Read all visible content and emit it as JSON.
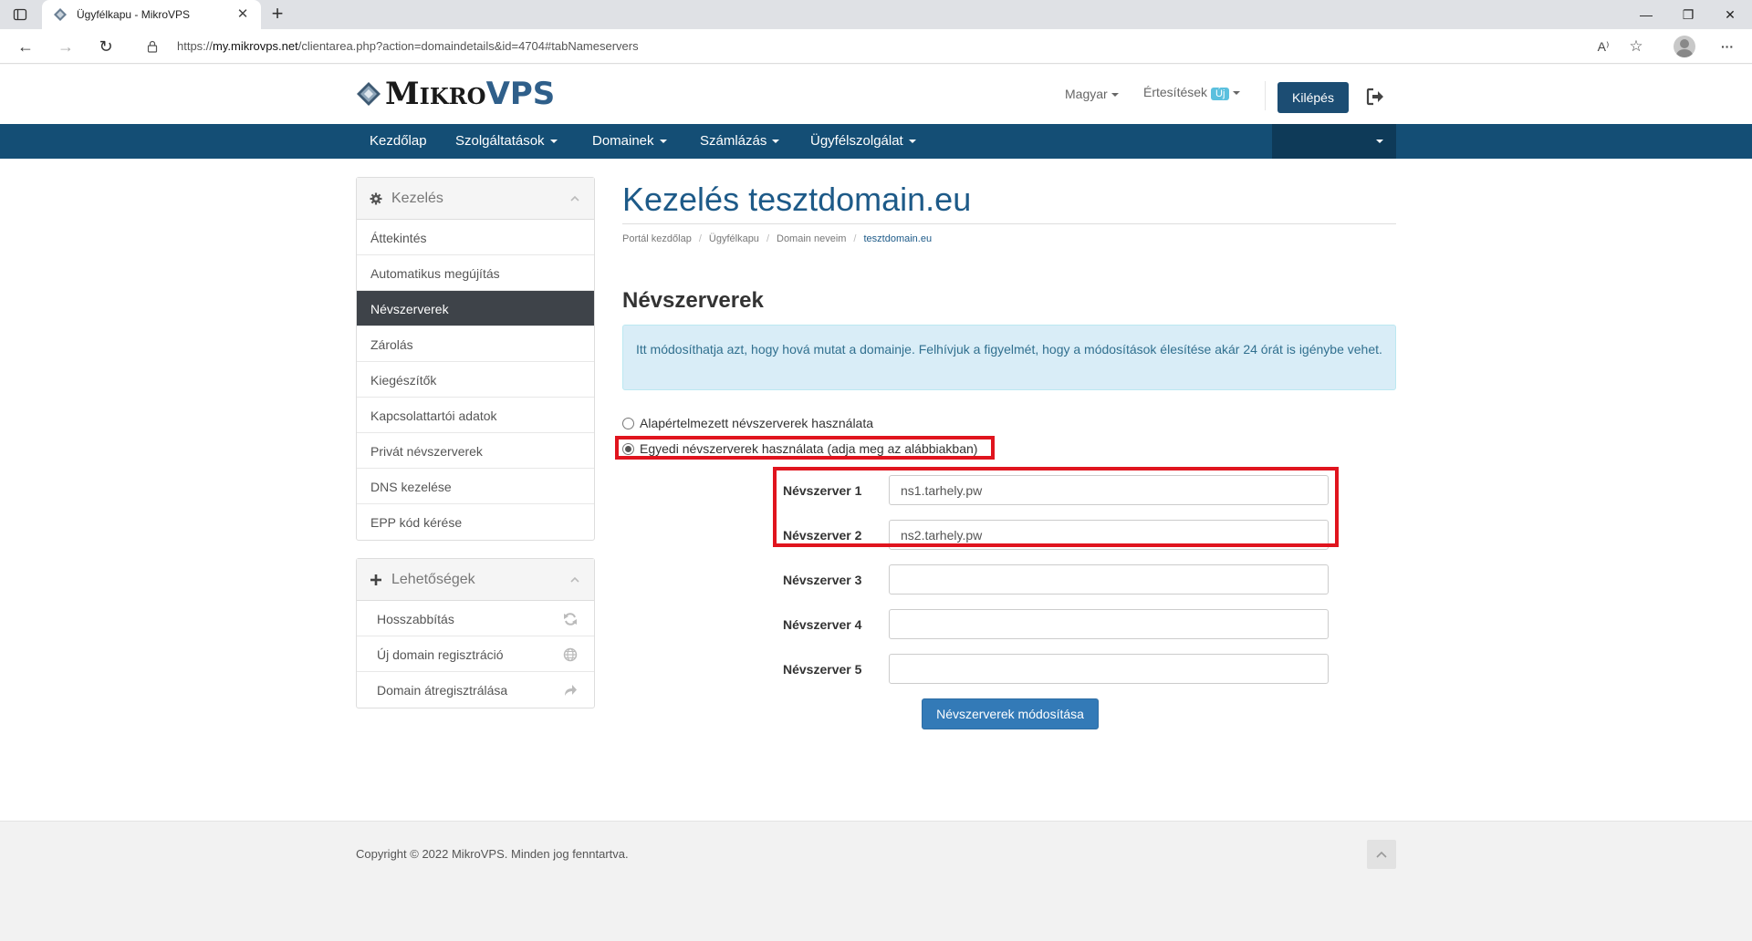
{
  "browser": {
    "tab_title": "Ügyfélkapu - MikroVPS",
    "url_prefix": "https://",
    "url_domain": "my.mikrovps.net",
    "url_path": "/clientarea.php?action=domaindetails&id=4704#tabNameservers",
    "new_tab_symbol": "+",
    "close_symbol": "✕",
    "minimize_symbol": "—",
    "restore_symbol": "❐",
    "window_close_symbol": "✕",
    "back_symbol": "←",
    "forward_symbol": "→",
    "reload_symbol": "↻",
    "read_aloud_symbol": "A⁾",
    "favorites_symbol": "☆",
    "more_symbol": "···"
  },
  "header": {
    "logo_part1": "Mikro",
    "logo_part2": "VPS",
    "language": "Magyar",
    "notifications": "Értesítések",
    "notifications_badge": "Új",
    "logout": "Kilépés"
  },
  "mainnav": {
    "items": [
      "Kezdőlap",
      "Szolgáltatások",
      "Domainek",
      "Számlázás",
      "Ügyfélszolgálat"
    ]
  },
  "sidebar": {
    "manage_title": "Kezelés",
    "manage_items": [
      "Áttekintés",
      "Automatikus megújítás",
      "Névszerverek",
      "Zárolás",
      "Kiegészítők",
      "Kapcsolattartói adatok",
      "Privát névszerverek",
      "DNS kezelése",
      "EPP kód kérése"
    ],
    "active_index": 2,
    "options_title": "Lehetőségek",
    "options_items": [
      "Hosszabbítás",
      "Új domain regisztráció",
      "Domain átregisztrálása"
    ]
  },
  "main": {
    "title": "Kezelés tesztdomain.eu",
    "breadcrumb": [
      "Portál kezdőlap",
      "Ügyfélkapu",
      "Domain neveim",
      "tesztdomain.eu"
    ],
    "section_title": "Névszerverek",
    "info": "Itt módosíthatja azt, hogy hová mutat a domainje. Felhívjuk a figyelmét, hogy a módosítások élesítése akár 24 órát is igénybe vehet.",
    "radio_default": "Alapértelmezett névszerverek használata",
    "radio_custom": "Egyedi névszerverek használata (adja meg az alábbiakban)",
    "radio_selected": "custom",
    "nameservers": [
      {
        "label": "Névszerver 1",
        "value": "ns1.tarhely.pw"
      },
      {
        "label": "Névszerver 2",
        "value": "ns2.tarhely.pw"
      },
      {
        "label": "Névszerver 3",
        "value": ""
      },
      {
        "label": "Névszerver 4",
        "value": ""
      },
      {
        "label": "Névszerver 5",
        "value": ""
      }
    ],
    "submit": "Névszerverek módosítása"
  },
  "footer": {
    "copyright": "Copyright © 2022 MikroVPS. Minden jog fenntartva."
  },
  "colors": {
    "brand_nav": "#144e75",
    "title_blue": "#1d5a88",
    "button_blue": "#337ab7",
    "highlight_red": "#e0141e",
    "info_bg": "#d9edf7"
  }
}
